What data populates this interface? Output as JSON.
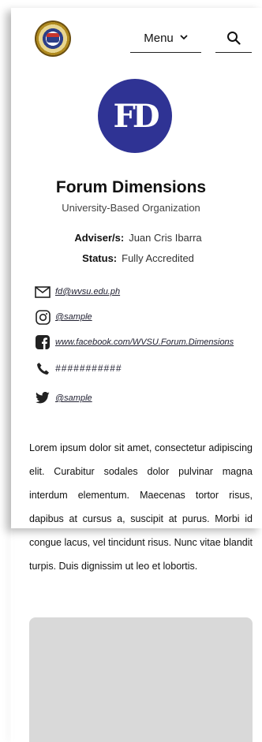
{
  "header": {
    "menu_label": "Menu",
    "menu_icon": "chevron-down-icon",
    "search_icon": "search-icon",
    "seal_icon": "university-seal-icon"
  },
  "org": {
    "logo_text": "FD",
    "name": "Forum Dimensions",
    "type": "University-Based Organization",
    "adviser_label": "Adviser/s:",
    "adviser_value": "Juan Cris Ibarra",
    "status_label": "Status:",
    "status_value": "Fully Accredited"
  },
  "contacts": {
    "email": "fd@wvsu.edu.ph",
    "instagram": "@sample",
    "facebook": "www.facebook.com/WVSU.Forum.Dimensions",
    "phone": "###########",
    "twitter": "@sample"
  },
  "description": "Lorem ipsum dolor sit amet, consectetur adipiscing elit. Curabitur sodales dolor pulvinar magna interdum elementum. Maecenas tortor risus, dapibus at cursus a, suscipit at purus. Morbi id congue lacus, vel tincidunt risus. Nunc vitae blandit turpis. Duis dignissim ut leo et lobortis.",
  "colors": {
    "logo_bg": "#2f3394",
    "placeholder": "#d9d9d9"
  }
}
